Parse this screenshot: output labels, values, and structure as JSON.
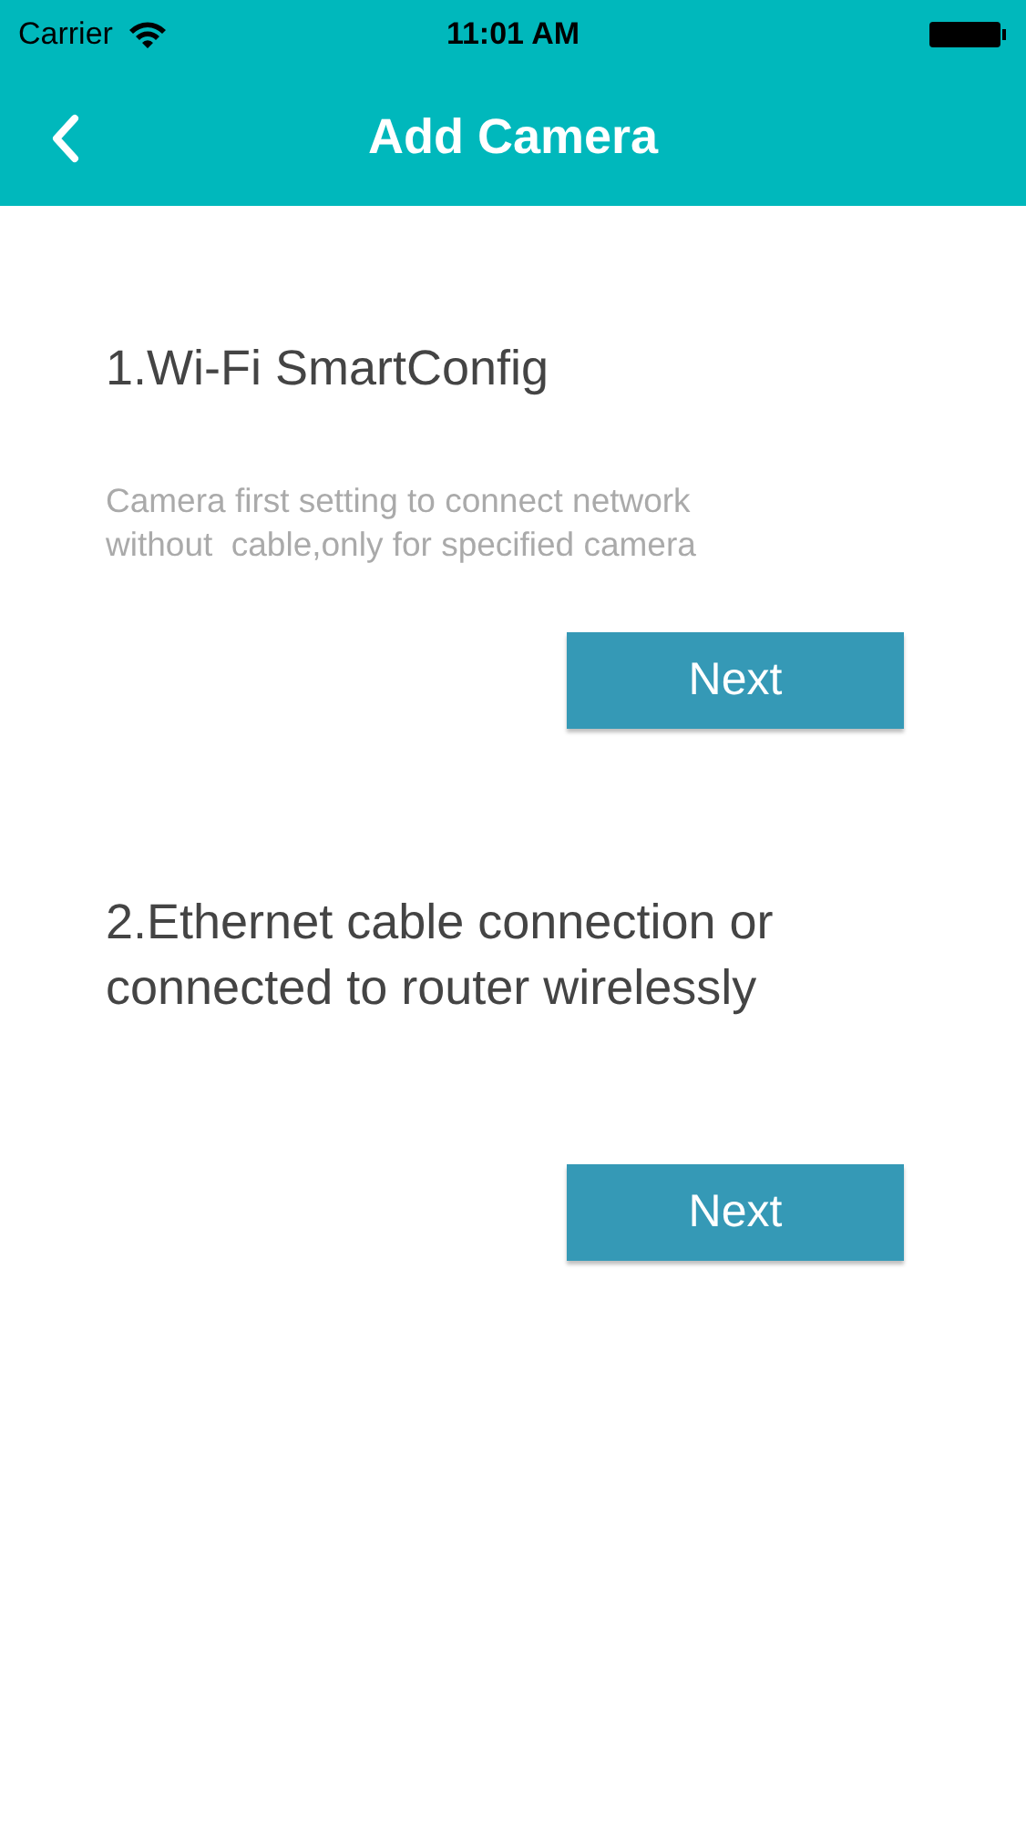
{
  "status_bar": {
    "carrier": "Carrier",
    "time": "11:01 AM"
  },
  "nav_bar": {
    "title": "Add Camera"
  },
  "options": [
    {
      "title": "1.Wi-Fi SmartConfig",
      "description": "Camera first setting to connect network\nwithout  cable,only for specified camera",
      "button": "Next"
    },
    {
      "title": "2.Ethernet cable connection or connected to router wirelessly",
      "button": "Next"
    }
  ]
}
